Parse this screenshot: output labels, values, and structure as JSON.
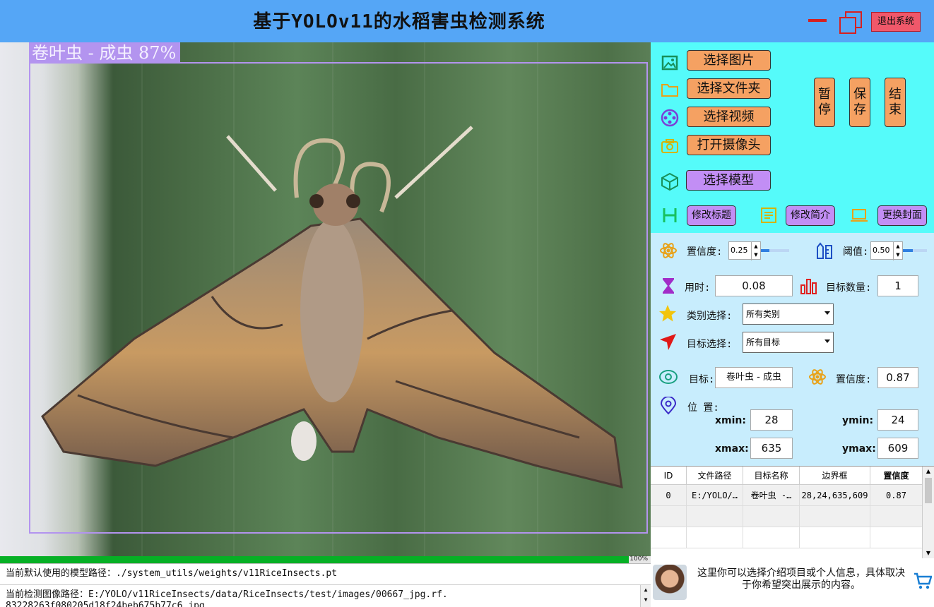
{
  "header": {
    "title": "基于YOLOv11的水稻害虫检测系统",
    "exit_label": "退出系统"
  },
  "viewer": {
    "detection_label": "卷叶虫 - 成虫 87%",
    "progress_value": 100,
    "progress_text": "100%",
    "box_color": "#b394ef"
  },
  "status": {
    "model_path": "当前默认使用的模型路径：./system_utils/weights/v11RiceInsects.pt",
    "image_path": "当前检测图像路径：E:/YOLO/v11RiceInsects/data/RiceInsects/test/images/00667_jpg.rf.",
    "image_path_cont": "83228263f080205d18f24beb675b77c6.jpg"
  },
  "controls": {
    "select_image": "选择图片",
    "select_folder": "选择文件夹",
    "select_video": "选择视频",
    "open_camera": "打开摄像头",
    "select_model": "选择模型",
    "pause": "暂停",
    "save": "保存",
    "end": "结束",
    "edit_title": "修改标题",
    "edit_intro": "修改简介",
    "change_cover": "更换封面"
  },
  "params": {
    "confidence_label": "置信度:",
    "confidence_value": "0.25",
    "threshold_label": "阈值:",
    "threshold_value": "0.50",
    "time_label": "用时:",
    "time_value": "0.08",
    "count_label": "目标数量:",
    "count_value": "1",
    "class_select_label": "类别选择:",
    "class_select_value": "所有类别",
    "target_select_label": "目标选择:",
    "target_select_value": "所有目标"
  },
  "result": {
    "target_label": "目标:",
    "target_value": "卷叶虫 - 成虫",
    "confidence_label": "置信度:",
    "confidence_value": "0.87",
    "position_label": "位 置:",
    "xmin_label": "xmin:",
    "xmin_value": "28",
    "ymin_label": "ymin:",
    "ymin_value": "24",
    "xmax_label": "xmax:",
    "xmax_value": "635",
    "ymax_label": "ymax:",
    "ymax_value": "609"
  },
  "table": {
    "headers": [
      "ID",
      "文件路径",
      "目标名称",
      "边界框",
      "置信度"
    ],
    "rows": [
      [
        "0",
        "E:/YOLO/…",
        "卷叶虫 -…",
        "28,24,635,609",
        "0.87"
      ]
    ]
  },
  "intro": {
    "text": "这里你可以选择介绍项目或个人信息，具体取决于你希望突出展示的内容。"
  },
  "colors": {
    "title_bar": "#55a6f6",
    "panel_top": "#55fbfa",
    "panel_mid": "#c8edfd",
    "button_orange": "#f5a162",
    "button_purple": "#c28ef5",
    "exit_red": "#f0586a"
  }
}
